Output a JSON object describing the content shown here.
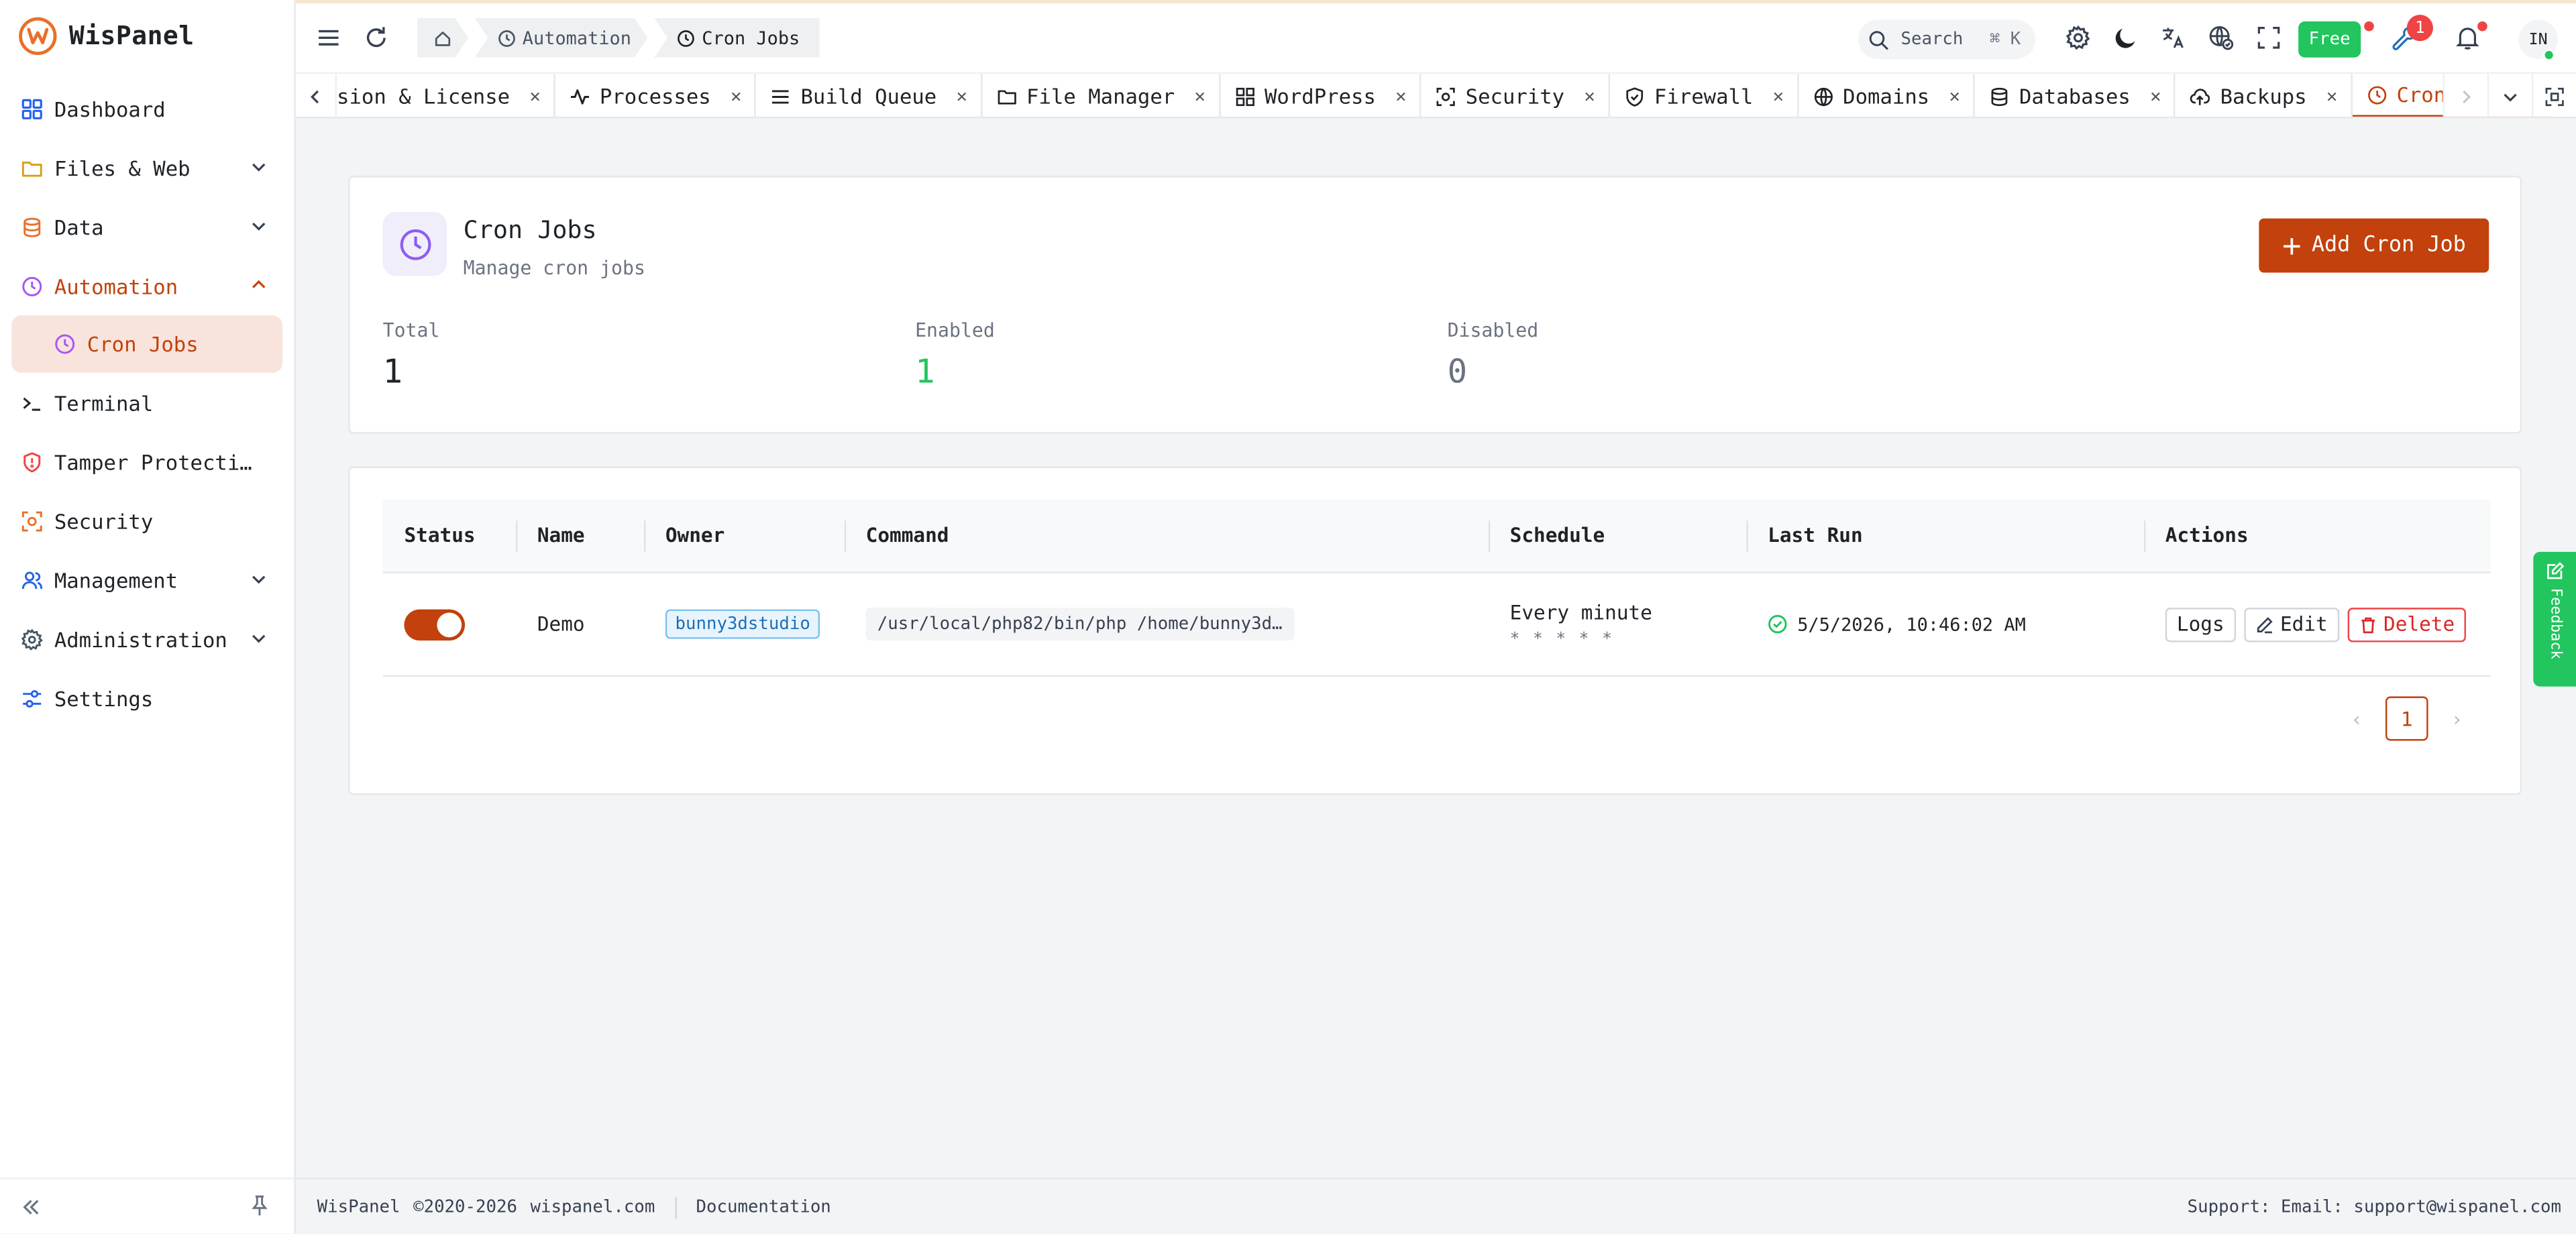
{
  "brand": {
    "name": "WisPanel"
  },
  "sidebar": {
    "items": [
      {
        "label": "Dashboard",
        "icon": "dashboard-icon"
      },
      {
        "label": "Files & Web",
        "icon": "folder-icon"
      },
      {
        "label": "Data",
        "icon": "database-icon"
      },
      {
        "label": "Automation",
        "icon": "clock-icon"
      },
      {
        "label": "Cron Jobs",
        "icon": "clock-icon"
      },
      {
        "label": "Terminal",
        "icon": "terminal-icon"
      },
      {
        "label": "Tamper Protecti…",
        "icon": "shield-icon"
      },
      {
        "label": "Security",
        "icon": "scan-icon"
      },
      {
        "label": "Management",
        "icon": "users-icon"
      },
      {
        "label": "Administration",
        "icon": "gear-icon"
      },
      {
        "label": "Settings",
        "icon": "sliders-icon"
      }
    ]
  },
  "header": {
    "breadcrumb": [
      "Automation",
      "Cron Jobs"
    ],
    "search_label": "Search",
    "search_shortcut": "⌘ K",
    "plan_badge": "Free",
    "notification_count": "1",
    "avatar_initials": "IN"
  },
  "tabs": [
    {
      "label": "sion & License",
      "icon": ""
    },
    {
      "label": "Processes",
      "icon": "activity-icon"
    },
    {
      "label": "Build Queue",
      "icon": "list-icon"
    },
    {
      "label": "File Manager",
      "icon": "folder-icon"
    },
    {
      "label": "WordPress",
      "icon": "grid-icon"
    },
    {
      "label": "Security",
      "icon": "scan-icon"
    },
    {
      "label": "Firewall",
      "icon": "shield-icon"
    },
    {
      "label": "Domains",
      "icon": "globe-icon"
    },
    {
      "label": "Databases",
      "icon": "database-icon"
    },
    {
      "label": "Backups",
      "icon": "cloud-upload-icon"
    },
    {
      "label": "Cron Jobs",
      "icon": "clock-icon",
      "active": true
    }
  ],
  "page": {
    "title": "Cron Jobs",
    "subtitle": "Manage cron jobs",
    "add_button": "Add Cron Job",
    "stats": [
      {
        "label": "Total",
        "value": "1"
      },
      {
        "label": "Enabled",
        "value": "1"
      },
      {
        "label": "Disabled",
        "value": "0"
      }
    ]
  },
  "table": {
    "columns": [
      "Status",
      "Name",
      "Owner",
      "Command",
      "Schedule",
      "Last Run",
      "Actions"
    ],
    "rows": [
      {
        "enabled": true,
        "name": "Demo",
        "owner": "bunny3dstudio",
        "command": "/usr/local/php82/bin/php /home/bunny3d…",
        "schedule": "Every minute",
        "cron": "* * * * *",
        "last_run": "5/5/2026, 10:46:02 AM",
        "actions": [
          "Logs",
          "Edit",
          "Delete"
        ]
      }
    ],
    "current_page": "1"
  },
  "feedback_label": "Feedback",
  "footer": {
    "brand": "WisPanel",
    "copyright": "©2020-2026",
    "site": "wispanel.com",
    "docs": "Documentation",
    "support": "Support:  Email: support@wispanel.com"
  },
  "colors": {
    "accent": "#c2410c",
    "success": "#22c55e",
    "danger": "#ef4444",
    "info": "#1d6fb8"
  }
}
